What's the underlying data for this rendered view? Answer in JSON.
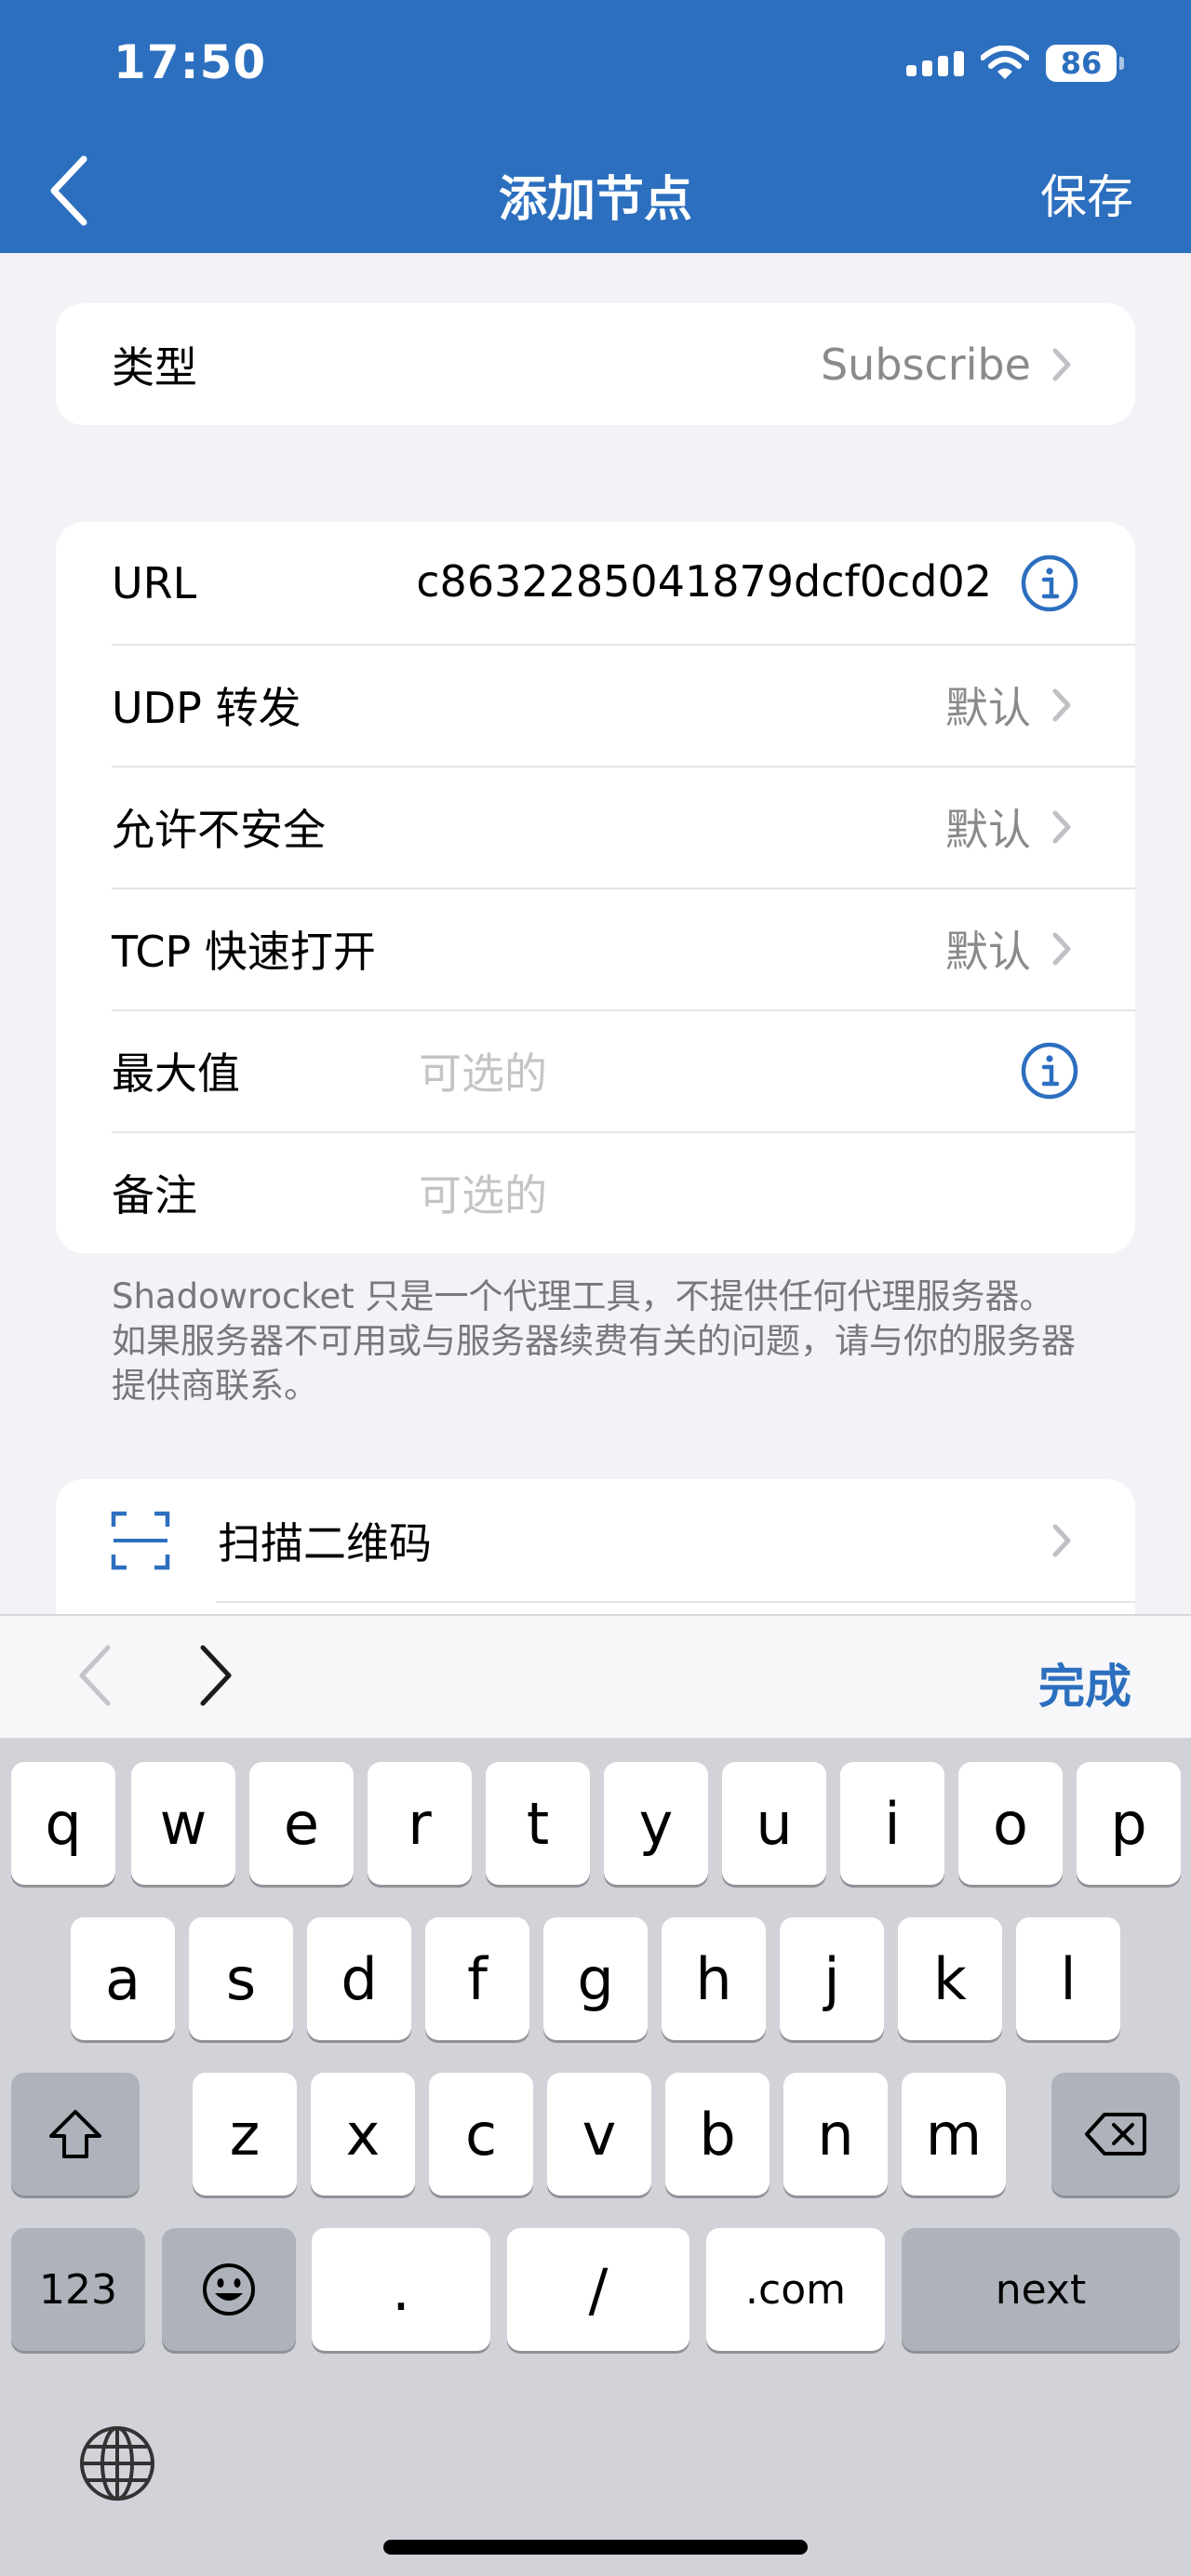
{
  "status_bar": {
    "time": "17:50",
    "battery": "86"
  },
  "nav": {
    "title": "添加节点",
    "save_label": "保存"
  },
  "type_row": {
    "label": "类型",
    "value": "Subscribe"
  },
  "form": {
    "url_label": "URL",
    "url_value": "c8632285041879dcf0cd02",
    "udp_label": "UDP 转发",
    "udp_value": "默认",
    "insecure_label": "允许不安全",
    "insecure_value": "默认",
    "tfo_label": "TCP 快速打开",
    "tfo_value": "默认",
    "max_label": "最大值",
    "max_placeholder": "可选的",
    "note_label": "备注",
    "note_placeholder": "可选的"
  },
  "footnote": "Shadowrocket 只是一个代理工具，不提供任何代理服务器。如果服务器不可用或与服务器续费有关的问题，请与你的服务器提供商联系。",
  "scan": {
    "label": "扫描二维码"
  },
  "toolbar": {
    "done_label": "完成"
  },
  "keyboard": {
    "row1": [
      "q",
      "w",
      "e",
      "r",
      "t",
      "y",
      "u",
      "i",
      "o",
      "p"
    ],
    "row2": [
      "a",
      "s",
      "d",
      "f",
      "g",
      "h",
      "j",
      "k",
      "l"
    ],
    "row3": [
      "z",
      "x",
      "c",
      "v",
      "b",
      "n",
      "m"
    ],
    "numbers_key": "123",
    "period_key": ".",
    "slash_key": "/",
    "dotcom_key": ".com",
    "next_key": "next"
  },
  "colors": {
    "accent": "#2c6fbf",
    "background": "#f2f2f7"
  }
}
